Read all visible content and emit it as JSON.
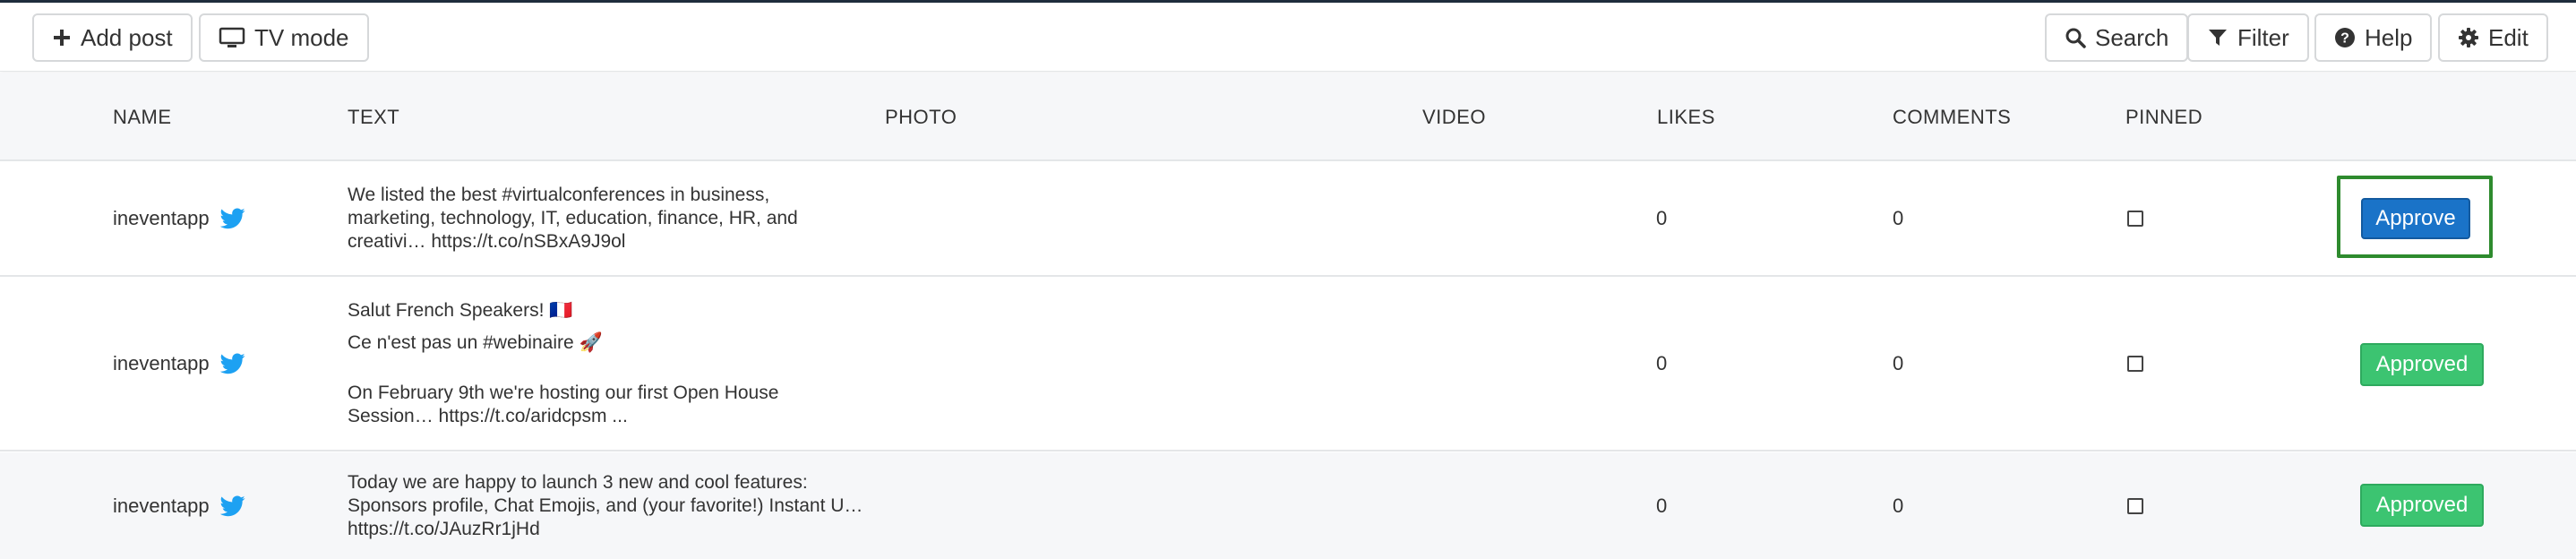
{
  "toolbar": {
    "add_post_label": "Add post",
    "tv_mode_label": "TV mode",
    "search_label": "Search",
    "filter_label": "Filter",
    "help_label": "Help",
    "edit_label": "Edit"
  },
  "table": {
    "headers": {
      "name": "NAME",
      "text": "TEXT",
      "photo": "PHOTO",
      "video": "VIDEO",
      "likes": "LIKES",
      "comments": "COMMENTS",
      "pinned": "PINNED"
    },
    "rows": [
      {
        "name": "ineventapp",
        "source_icon": "twitter-icon",
        "text": [
          "We listed the best #virtualconferences in business,",
          "marketing, technology, IT, education, finance, HR, and",
          "creativi… https://t.co/nSBxA9J9ol"
        ],
        "likes": "0",
        "comments": "0",
        "pinned": false,
        "action": "Approve"
      },
      {
        "name": "ineventapp",
        "source_icon": "twitter-icon",
        "text": [
          "Salut French Speakers! 🇫🇷",
          "Ce n'est pas un #webinaire 🚀",
          "On February 9th we're hosting our first Open House",
          "Session… https://t.co/aridcpsm ..."
        ],
        "likes": "0",
        "comments": "0",
        "pinned": false,
        "action": "Approved"
      },
      {
        "name": "ineventapp",
        "source_icon": "twitter-icon",
        "text": [
          "Today we are happy to launch 3 new and cool features:",
          "Sponsors profile, Chat Emojis, and (your favorite!) Instant U…",
          "https://t.co/JAuzRr1jHd"
        ],
        "likes": "0",
        "comments": "0",
        "pinned": false,
        "action": "Approved"
      }
    ]
  },
  "colors": {
    "approve_button": "#1a73c8",
    "approved_button": "#3cc471",
    "twitter_blue": "#1da1f2",
    "focus_outline": "#2e8b2e"
  }
}
